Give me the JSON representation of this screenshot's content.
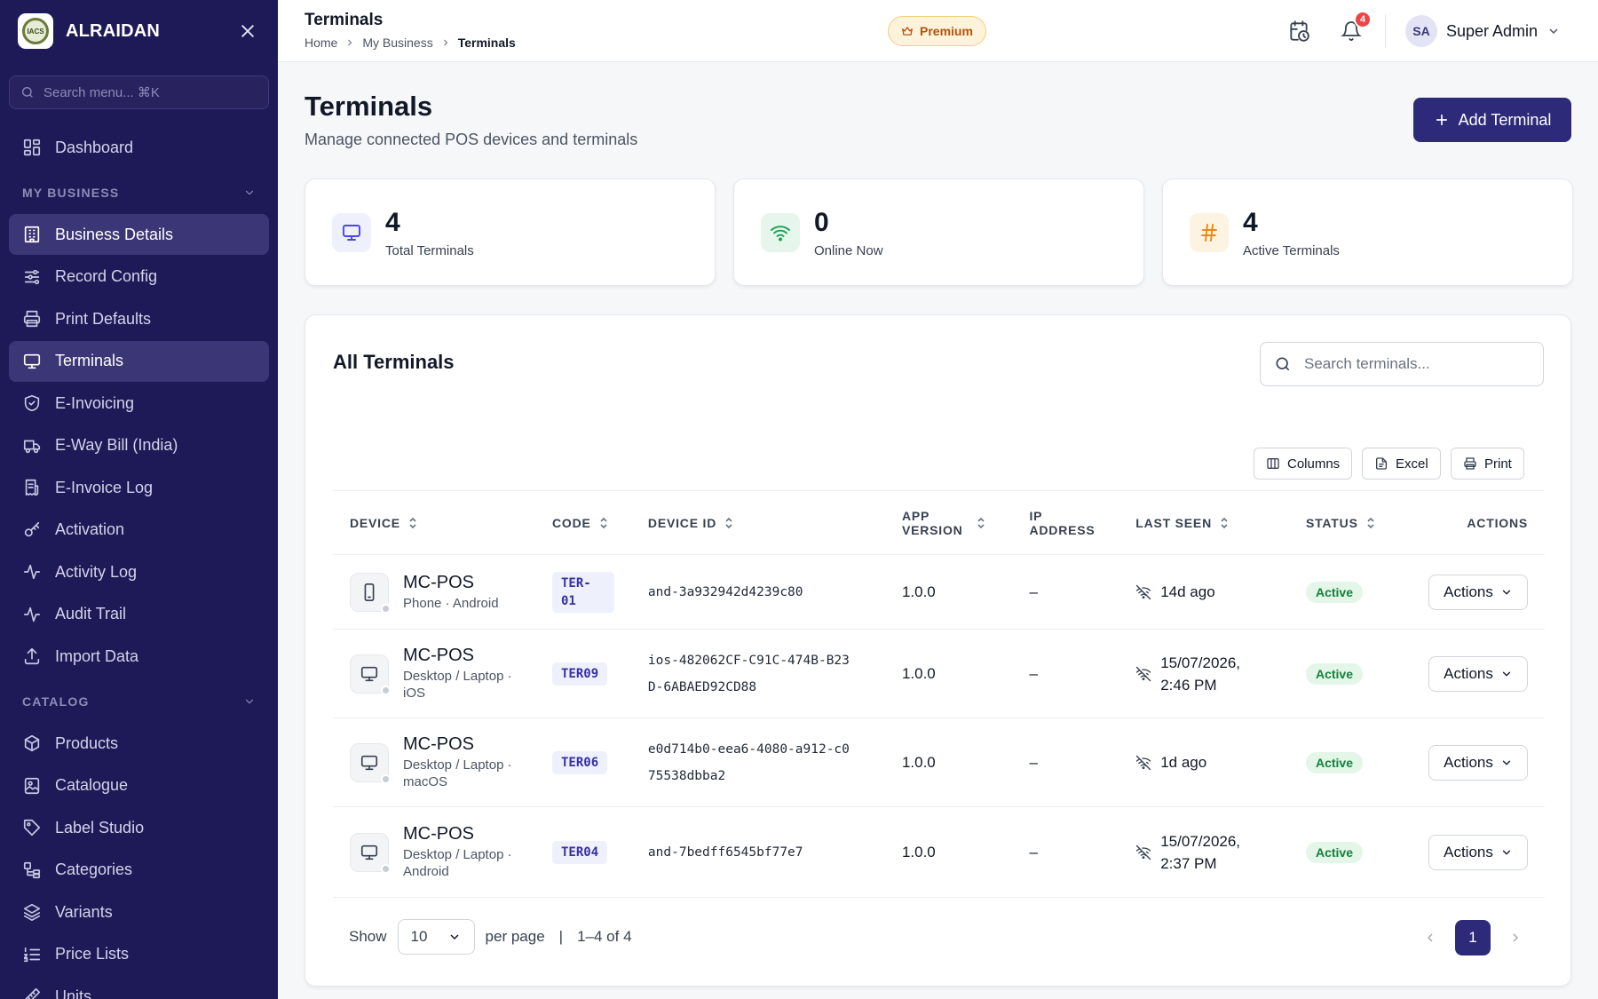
{
  "sidebar": {
    "brand": "ALRAIDAN",
    "logo_text": "IACS",
    "search_placeholder": "Search menu... ⌘K",
    "top_items": [
      {
        "label": "Dashboard",
        "icon": "dashboard-icon"
      }
    ],
    "sections": [
      {
        "title": "MY BUSINESS",
        "items": [
          {
            "label": "Business Details",
            "icon": "building-icon",
            "active": true
          },
          {
            "label": "Record Config",
            "icon": "sliders-icon"
          },
          {
            "label": "Print Defaults",
            "icon": "printer-icon"
          },
          {
            "label": "Terminals",
            "icon": "monitor-icon",
            "active": true
          },
          {
            "label": "E-Invoicing",
            "icon": "shield-check-icon"
          },
          {
            "label": "E-Way Bill (India)",
            "icon": "truck-icon"
          },
          {
            "label": "E-Invoice Log",
            "icon": "receipt-icon"
          },
          {
            "label": "Activation",
            "icon": "key-icon"
          },
          {
            "label": "Activity Log",
            "icon": "activity-icon"
          },
          {
            "label": "Audit Trail",
            "icon": "activity-icon"
          },
          {
            "label": "Import Data",
            "icon": "upload-icon"
          }
        ]
      },
      {
        "title": "CATALOG",
        "items": [
          {
            "label": "Products",
            "icon": "box-icon"
          },
          {
            "label": "Catalogue",
            "icon": "image-book-icon"
          },
          {
            "label": "Label Studio",
            "icon": "tag-icon"
          },
          {
            "label": "Categories",
            "icon": "categories-icon"
          },
          {
            "label": "Variants",
            "icon": "layers-icon"
          },
          {
            "label": "Price Lists",
            "icon": "list-ordered-icon"
          },
          {
            "label": "Units",
            "icon": "ruler-icon"
          }
        ]
      }
    ]
  },
  "header": {
    "title": "Terminals",
    "breadcrumb": [
      "Home",
      "My Business",
      "Terminals"
    ],
    "premium_label": "Premium",
    "notification_count": "4",
    "user_initials": "SA",
    "user_name": "Super Admin"
  },
  "page": {
    "title": "Terminals",
    "subtitle": "Manage connected POS devices and terminals",
    "add_button": "Add Terminal"
  },
  "stats": [
    {
      "value": "4",
      "label": "Total Terminals",
      "icon": "monitor-icon",
      "color": "#4f46e5",
      "bg": "#eef0fb"
    },
    {
      "value": "0",
      "label": "Online Now",
      "icon": "wifi-icon",
      "color": "#16a34a",
      "bg": "#e6f6ec"
    },
    {
      "value": "4",
      "label": "Active Terminals",
      "icon": "hash-icon",
      "color": "#ea8a0c",
      "bg": "#fdf3e2"
    }
  ],
  "table": {
    "title": "All Terminals",
    "search_placeholder": "Search terminals...",
    "toolbar": {
      "columns": "Columns",
      "excel": "Excel",
      "print": "Print"
    },
    "headers": {
      "device": "DEVICE",
      "code": "CODE",
      "device_id": "DEVICE ID",
      "app_version": "APP VERSION",
      "ip_address": "IP ADDRESS",
      "last_seen": "LAST SEEN",
      "status": "STATUS",
      "actions": "ACTIONS"
    },
    "rows": [
      {
        "name": "MC-POS",
        "meta": "Phone · Android",
        "device_type": "phone",
        "code": "TER-01",
        "device_id": "and-3a932942d4239c80",
        "app_version": "1.0.0",
        "ip": "–",
        "last_seen": "14d ago",
        "status": "Active",
        "action": "Actions"
      },
      {
        "name": "MC-POS",
        "meta": "Desktop / Laptop · iOS",
        "device_type": "desktop",
        "code": "TER09",
        "device_id": "ios-482062CF-C91C-474B-B23D-6ABAED92CD88",
        "app_version": "1.0.0",
        "ip": "–",
        "last_seen": "15/07/2026, 2:46 PM",
        "status": "Active",
        "action": "Actions"
      },
      {
        "name": "MC-POS",
        "meta": "Desktop / Laptop · macOS",
        "device_type": "desktop",
        "code": "TER06",
        "device_id": "e0d714b0-eea6-4080-a912-c075538dbba2",
        "app_version": "1.0.0",
        "ip": "–",
        "last_seen": "1d ago",
        "status": "Active",
        "action": "Actions"
      },
      {
        "name": "MC-POS",
        "meta": "Desktop / Laptop · Android",
        "device_type": "desktop",
        "code": "TER04",
        "device_id": "and-7bedff6545bf77e7",
        "app_version": "1.0.0",
        "ip": "–",
        "last_seen": "15/07/2026, 2:37 PM",
        "status": "Active",
        "action": "Actions"
      }
    ]
  },
  "pagination": {
    "show_label": "Show",
    "per_page_value": "10",
    "per_page_label": "per page",
    "separator": "|",
    "range": "1–4 of 4",
    "current_page": "1"
  }
}
